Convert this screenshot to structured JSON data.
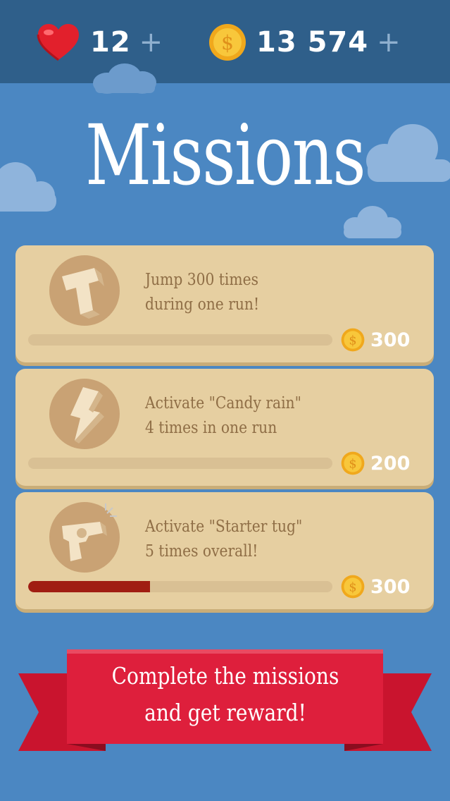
{
  "hud": {
    "lives": {
      "icon": "heart-icon",
      "value": "12",
      "add": "+"
    },
    "coins": {
      "icon": "coin-icon",
      "value": "13 574",
      "add": "+"
    }
  },
  "title": "Missions",
  "missions": [
    {
      "icon": "letter-t-icon",
      "line1": "Jump 300 times",
      "line2": "during one run!",
      "progress": 0,
      "reward": "300",
      "reward_icon": "coin-icon"
    },
    {
      "icon": "lightning-icon",
      "line1": "Activate \"Candy rain\"",
      "line2": "4 times in one run",
      "progress": 0,
      "reward": "200",
      "reward_icon": "coin-icon"
    },
    {
      "icon": "pistol-icon",
      "line1": "Activate \"Starter tug\"",
      "line2": "5 times overall!",
      "progress": 0.4,
      "reward": "300",
      "reward_icon": "coin-icon"
    }
  ],
  "banner": {
    "line1": "Complete the missions",
    "line2": "and get reward!"
  },
  "colors": {
    "background": "#4b87c2",
    "topbar": "#2f5f8a",
    "card": "#e6cfa1",
    "progress_fill": "#a01d12",
    "banner": "#d81d3a"
  }
}
